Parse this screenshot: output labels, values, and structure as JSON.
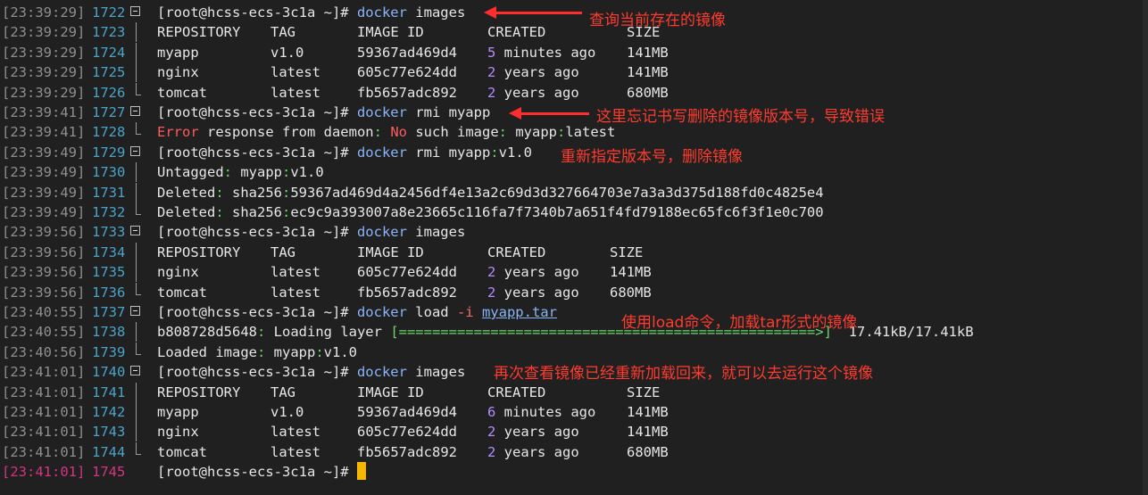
{
  "rows": [
    {
      "ts": "[23:39:29]",
      "ln": "1722",
      "kind": "prompt",
      "prompt": "[root@hcss-ecs-3c1a ~]#",
      "cmd": "docker",
      "args": "images"
    },
    {
      "ts": "[23:39:29]",
      "ln": "1723",
      "kind": "table",
      "cells": [
        "REPOSITORY",
        "TAG",
        "IMAGE ID",
        "CREATED",
        "SIZE"
      ]
    },
    {
      "ts": "[23:39:29]",
      "ln": "1724",
      "kind": "table",
      "cells": [
        "myapp",
        "v1.0",
        "59367ad469d4",
        "5 minutes ago",
        "141MB"
      ]
    },
    {
      "ts": "[23:39:29]",
      "ln": "1725",
      "kind": "table",
      "cells": [
        "nginx",
        "latest",
        "605c77e624dd",
        "2 years ago",
        "141MB"
      ]
    },
    {
      "ts": "[23:39:29]",
      "ln": "1726",
      "kind": "table",
      "cells": [
        "tomcat",
        "latest",
        "fb5657adc892",
        "2 years ago",
        "680MB"
      ]
    },
    {
      "ts": "[23:39:41]",
      "ln": "1727",
      "kind": "prompt",
      "prompt": "[root@hcss-ecs-3c1a ~]#",
      "cmd": "docker",
      "args": "rmi myapp"
    },
    {
      "ts": "[23:39:41]",
      "ln": "1728",
      "kind": "error",
      "text": "Error response from daemon: No such image: myapp:latest"
    },
    {
      "ts": "[23:39:49]",
      "ln": "1729",
      "kind": "prompt",
      "prompt": "[root@hcss-ecs-3c1a ~]#",
      "cmd": "docker",
      "args": "rmi myapp:v1.0"
    },
    {
      "ts": "[23:39:49]",
      "ln": "1730",
      "kind": "plain",
      "text": "Untagged: myapp:v1.0"
    },
    {
      "ts": "[23:39:49]",
      "ln": "1731",
      "kind": "plain",
      "text": "Deleted: sha256:59367ad469d4a2456df4e13a2c69d3d327664703e7a3a3d375d188fd0c4825e4"
    },
    {
      "ts": "[23:39:49]",
      "ln": "1732",
      "kind": "plain",
      "text": "Deleted: sha256:ec9c9a393007a8e23665c116fa7f7340b7a651f4fd79188ec65fc6f3f1e0c700"
    },
    {
      "ts": "[23:39:56]",
      "ln": "1733",
      "kind": "prompt",
      "prompt": "[root@hcss-ecs-3c1a ~]#",
      "cmd": "docker",
      "args": "images"
    },
    {
      "ts": "[23:39:56]",
      "ln": "1734",
      "kind": "table2",
      "cells": [
        "REPOSITORY",
        "TAG",
        "IMAGE ID",
        "CREATED",
        "SIZE"
      ]
    },
    {
      "ts": "[23:39:56]",
      "ln": "1735",
      "kind": "table2",
      "cells": [
        "nginx",
        "latest",
        "605c77e624dd",
        "2 years ago",
        "141MB"
      ]
    },
    {
      "ts": "[23:39:56]",
      "ln": "1736",
      "kind": "table2",
      "cells": [
        "tomcat",
        "latest",
        "fb5657adc892",
        "2 years ago",
        "680MB"
      ]
    },
    {
      "ts": "[23:40:55]",
      "ln": "1737",
      "kind": "prompt_load",
      "prompt": "[root@hcss-ecs-3c1a ~]#",
      "cmd": "docker",
      "args": "load",
      "flag": "-i",
      "file": "myapp.tar"
    },
    {
      "ts": "[23:40:55]",
      "ln": "1738",
      "kind": "progress",
      "label": "b808728d5648: Loading layer",
      "bar": "[==================================================>]",
      "amount": "17.41kB/17.41kB"
    },
    {
      "ts": "[23:40:56]",
      "ln": "1739",
      "kind": "plain",
      "text": "Loaded image: myapp:v1.0"
    },
    {
      "ts": "[23:41:01]",
      "ln": "1740",
      "kind": "prompt",
      "prompt": "[root@hcss-ecs-3c1a ~]#",
      "cmd": "docker",
      "args": "images"
    },
    {
      "ts": "[23:41:01]",
      "ln": "1741",
      "kind": "table",
      "cells": [
        "REPOSITORY",
        "TAG",
        "IMAGE ID",
        "CREATED",
        "SIZE"
      ]
    },
    {
      "ts": "[23:41:01]",
      "ln": "1742",
      "kind": "table",
      "cells": [
        "myapp",
        "v1.0",
        "59367ad469d4",
        "6 minutes ago",
        "141MB"
      ]
    },
    {
      "ts": "[23:41:01]",
      "ln": "1743",
      "kind": "table",
      "cells": [
        "nginx",
        "latest",
        "605c77e624dd",
        "2 years ago",
        "141MB"
      ]
    },
    {
      "ts": "[23:41:01]",
      "ln": "1744",
      "kind": "table",
      "cells": [
        "tomcat",
        "latest",
        "fb5657adc892",
        "2 years ago",
        "680MB"
      ]
    },
    {
      "ts": "[23:41:01]",
      "ln": "1745",
      "kind": "cursor",
      "prompt": "[root@hcss-ecs-3c1a ~]#"
    }
  ],
  "annotations": {
    "a1": "查询当前存在的镜像",
    "a2": "这里忘记书写删除的镜像版本号，导致错误",
    "a3": "重新指定版本号，删除镜像",
    "a4": "使用load命令，加载tar形式的镜像",
    "a5": "再次查看镜像已经重新加载回来，就可以去运行这个镜像"
  },
  "colors": {
    "annotation": "#ff3b2f",
    "cursor": "#f2b705",
    "timestamp_active": "#d63384"
  }
}
